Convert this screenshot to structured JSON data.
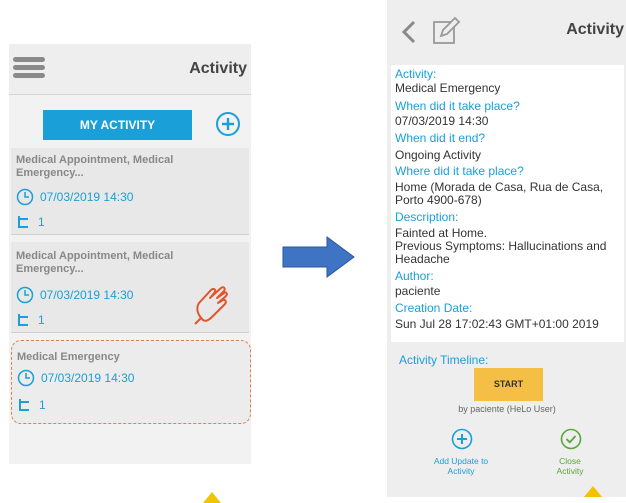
{
  "left": {
    "title": "Activity",
    "my_activity_label": "MY ACTIVITY",
    "cards": [
      {
        "title": "Medical Appointment, Medical Emergency...",
        "datetime": "07/03/2019 14:30",
        "count": "1"
      },
      {
        "title": "Medical Appointment, Medical Emergency...",
        "datetime": "07/03/2019 14:30",
        "count": "1"
      },
      {
        "title": "Medical Emergency",
        "datetime": "07/03/2019 14:30",
        "count": "1"
      }
    ]
  },
  "right": {
    "title": "Activity",
    "details": {
      "activity_label": "Activity:",
      "activity_value": "Medical Emergency",
      "when_label": "When did it take place?",
      "when_value": "07/03/2019 14:30",
      "end_label": "When did it end?",
      "end_value": "Ongoing Activity",
      "where_label": "Where did it take place?",
      "where_value": "Home (Morada de Casa, Rua de Casa, Porto 4900-678)",
      "description_label": "Description:",
      "description_line1": "Fainted at Home.",
      "description_line2": "Previous Symptoms: Hallucinations and Headache",
      "author_label": "Author:",
      "author_value": "paciente",
      "creation_label": "Creation Date:",
      "creation_value": "Sun Jul 28 17:02:43 GMT+01:00 2019"
    },
    "timeline_label": "Activity Timeline:",
    "start_label": "START",
    "by_user": "by paciente (HeLo User)",
    "add_update_label": "Add Update to Activity",
    "close_label": "Close Activity"
  },
  "colors": {
    "accent": "#1a9fd8",
    "start": "#f5bf45",
    "close": "#5aa53a",
    "highlight": "#e37d4f",
    "pointer": "#f2c300"
  }
}
